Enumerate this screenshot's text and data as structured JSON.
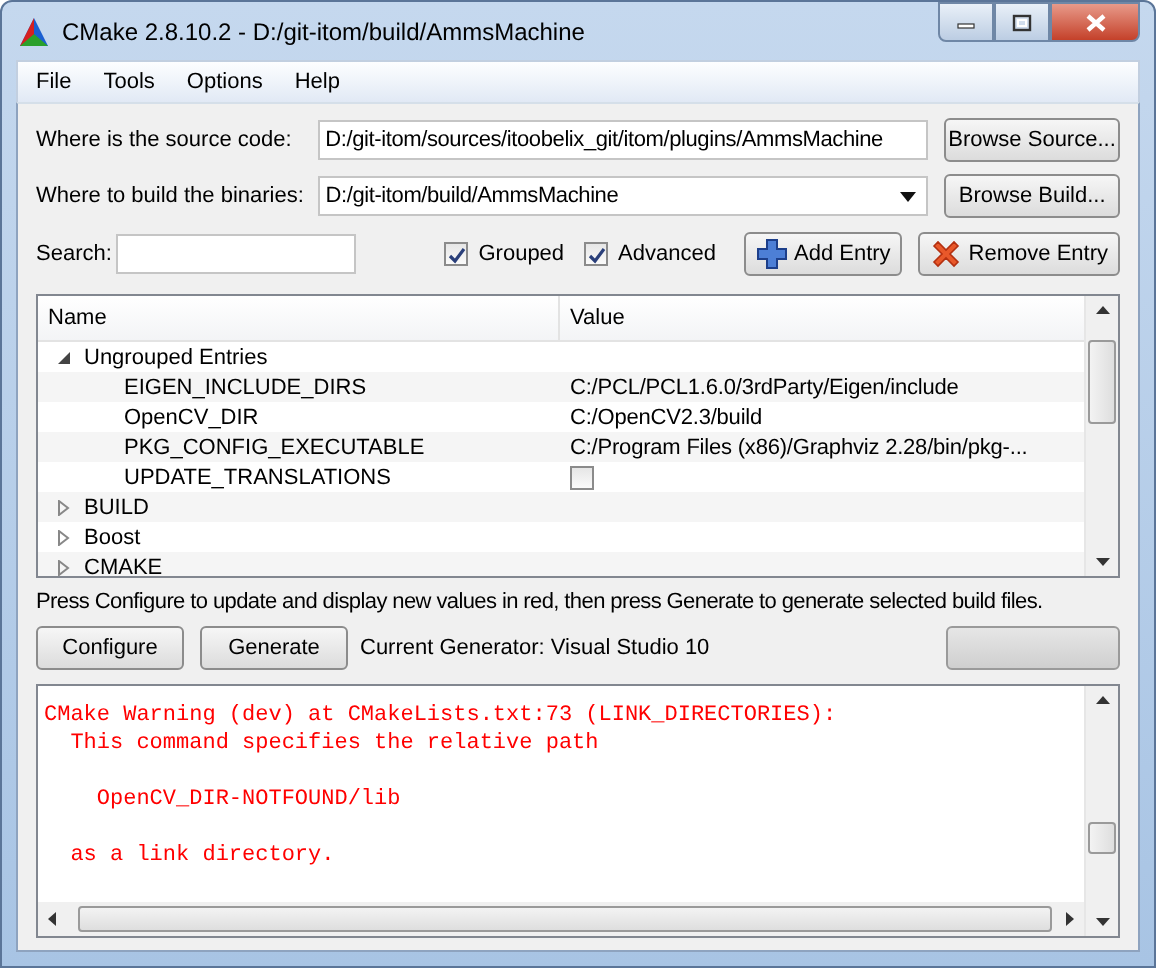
{
  "window": {
    "title": "CMake 2.8.10.2 - D:/git-itom/build/AmmsMachine"
  },
  "menu": [
    "File",
    "Tools",
    "Options",
    "Help"
  ],
  "source": {
    "label": "Where is the source code:",
    "value": "D:/git-itom/sources/itoobelix_git/itom/plugins/AmmsMachine",
    "button": "Browse Source..."
  },
  "build": {
    "label": "Where to build the binaries:",
    "value": "D:/git-itom/build/AmmsMachine",
    "button": "Browse Build..."
  },
  "search": {
    "label": "Search:"
  },
  "options": [
    {
      "label": "Grouped",
      "checked": true
    },
    {
      "label": "Advanced",
      "checked": true
    }
  ],
  "entry_buttons": [
    {
      "kind": "add",
      "label": "Add Entry"
    },
    {
      "kind": "remove",
      "label": "Remove Entry"
    }
  ],
  "table": {
    "columns": [
      "Name",
      "Value"
    ],
    "groups": [
      {
        "name": "Ungrouped Entries",
        "expanded": true,
        "children": [
          {
            "name": "EIGEN_INCLUDE_DIRS",
            "kind": "path",
            "value": "C:/PCL/PCL1.6.0/3rdParty/Eigen/include"
          },
          {
            "name": "OpenCV_DIR",
            "kind": "path",
            "value": "C:/OpenCV2.3/build"
          },
          {
            "name": "PKG_CONFIG_EXECUTABLE",
            "kind": "path",
            "value": "C:/Program Files (x86)/Graphviz 2.28/bin/pkg-..."
          },
          {
            "name": "UPDATE_TRANSLATIONS",
            "kind": "bool",
            "checked": false
          }
        ]
      },
      {
        "name": "BUILD",
        "expanded": false
      },
      {
        "name": "Boost",
        "expanded": false
      },
      {
        "name": "CMAKE",
        "expanded": false
      }
    ]
  },
  "hint": "Press Configure to update and display new values in red, then press Generate to generate selected build files.",
  "actions": [
    "Configure",
    "Generate"
  ],
  "generator": "Current Generator: Visual Studio 10",
  "progress": {
    "level": 0
  },
  "output": [
    {
      "kind": "warning",
      "text": "CMake Warning (dev) at CMakeLists.txt:73 (LINK_DIRECTORIES):\n  This command specifies the relative path\n\n    OpenCV_DIR-NOTFOUND/lib\n\n  as a link directory."
    }
  ]
}
